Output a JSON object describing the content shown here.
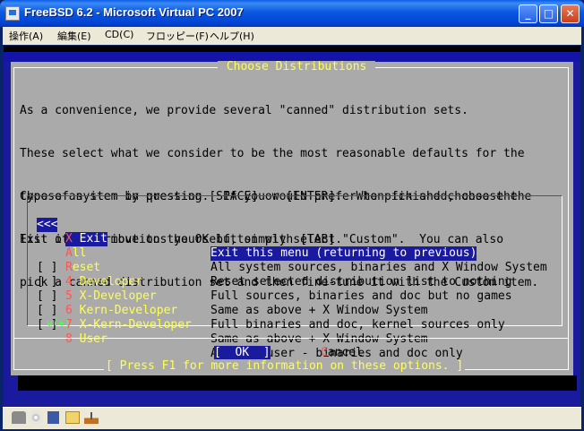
{
  "window": {
    "title": "FreeBSD 6.2 - Microsoft Virtual PC 2007",
    "controls": {
      "minimize": "_",
      "maximize": "□",
      "close": "✕"
    }
  },
  "menubar": {
    "items": [
      {
        "label": "操作(A)"
      },
      {
        "label": "編集(E)"
      },
      {
        "label": "CD(C)"
      },
      {
        "label": "フロッピー(F)"
      },
      {
        "label": "ヘルプ(H)"
      }
    ]
  },
  "dialog": {
    "title": " Choose Distributions ",
    "intro_lines": [
      "As a convenience, we provide several \"canned\" distribution sets.",
      "These select what we consider to be the most reasonable defaults for the",
      "type of system in question.  If you would prefer to pick and choose the",
      "list of distributions yourself, simply select \"Custom\".  You can also",
      "pick a canned distribution set and then fine-tune it with the Custom item."
    ],
    "instruction_lines": [
      "Choose an item by pressing [SPACE] or [ENTER].  When finished, choose the",
      "Exit item or move to the OK button with [TAB]."
    ],
    "items": [
      {
        "check": "<<<",
        "hotkey": "X",
        "name": " Exit",
        "desc": "Exit this menu (returning to previous)",
        "selected": true
      },
      {
        "check": "",
        "hotkey": "A",
        "name": "ll",
        "desc": "All system sources, binaries and X Window System",
        "selected": false
      },
      {
        "check": "",
        "hotkey": "R",
        "name": "eset",
        "desc": "Reset selected distribution list to nothing",
        "selected": false
      },
      {
        "check": "[ ]",
        "hotkey": "4",
        "name": " Developer",
        "desc": "Full sources, binaries and doc but no games",
        "selected": false
      },
      {
        "check": "[ ]",
        "hotkey": "5",
        "name": " X-Developer",
        "desc": "Same as above + X Window System",
        "selected": false
      },
      {
        "check": "[ ]",
        "hotkey": "6",
        "name": " Kern-Developer",
        "desc": "Full binaries and doc, kernel sources only",
        "selected": false
      },
      {
        "check": "[ ]",
        "hotkey": "7",
        "name": " X-Kern-Developer",
        "desc": "Same as above + X Window System",
        "selected": false
      },
      {
        "check": "[ ]",
        "hotkey": "8",
        "name": " User",
        "desc": "Average user - binaries and doc only",
        "selected": false
      }
    ],
    "more_indicator": "v(+)",
    "ok_label": "[  OK  ]",
    "cancel_hotkey": "C",
    "cancel_rest": "ancel",
    "help_line": "[ Press F1 for more information on these options. ]"
  },
  "statusbar": {
    "icons": [
      "network-icon",
      "cd-icon",
      "floppy-icon",
      "shared-folder-icon",
      "usb-icon"
    ]
  }
}
